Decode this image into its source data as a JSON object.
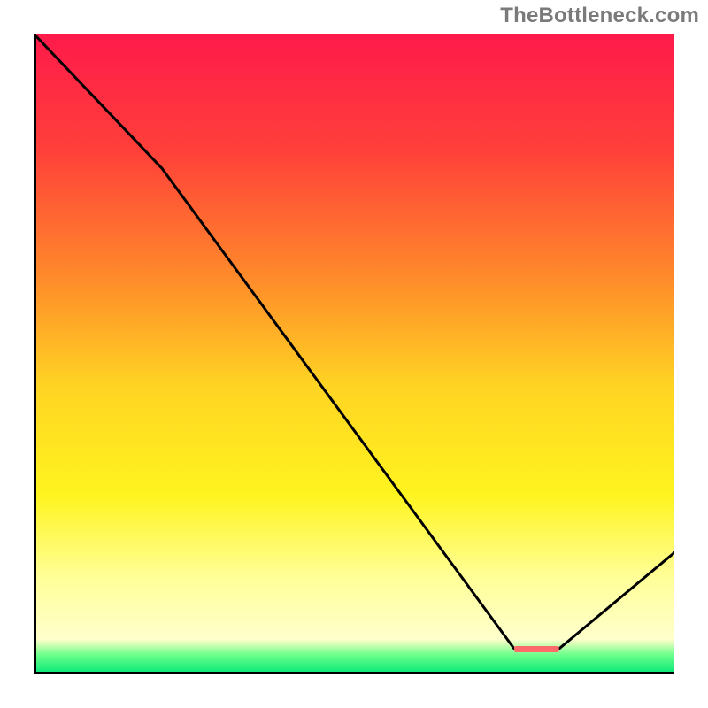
{
  "watermark": "TheBottleneck.com",
  "chart_data": {
    "type": "line",
    "title": "",
    "xlabel": "",
    "ylabel": "",
    "xlim": [
      0,
      100
    ],
    "ylim": [
      0,
      100
    ],
    "x": [
      0,
      20,
      75,
      82,
      100
    ],
    "values": [
      100,
      79,
      4,
      4,
      19
    ],
    "gradient_stops": [
      {
        "offset": 0.0,
        "color": "#ff1a4b"
      },
      {
        "offset": 0.18,
        "color": "#ff3f3a"
      },
      {
        "offset": 0.38,
        "color": "#ff8a2a"
      },
      {
        "offset": 0.55,
        "color": "#ffd423"
      },
      {
        "offset": 0.72,
        "color": "#fff41f"
      },
      {
        "offset": 0.85,
        "color": "#ffff99"
      },
      {
        "offset": 0.945,
        "color": "#ffffcc"
      },
      {
        "offset": 0.955,
        "color": "#c8ffb0"
      },
      {
        "offset": 0.97,
        "color": "#6aff8a"
      },
      {
        "offset": 1.0,
        "color": "#00e676"
      }
    ],
    "marker": {
      "x_start": 75,
      "x_end": 82,
      "y": 4,
      "color": "#ff6b6b"
    }
  }
}
